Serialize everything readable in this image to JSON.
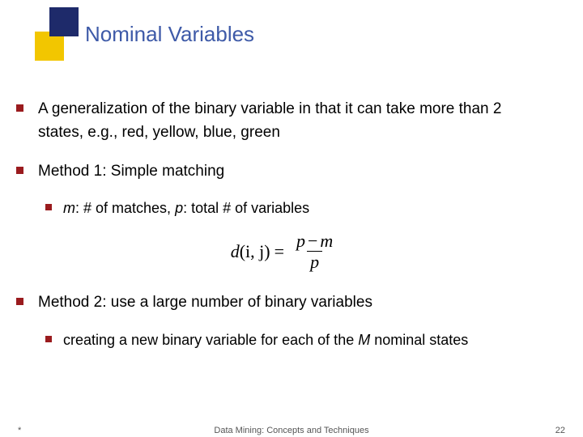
{
  "title": "Nominal Variables",
  "bullets": {
    "b1": "A generalization of the binary variable in that it can take more than 2 states, e.g., red, yellow, blue, green",
    "b2": "Method 1: Simple matching",
    "b2a_m": "m",
    "b2a_mid": ": # of matches, ",
    "b2a_p": "p",
    "b2a_end": ": total # of variables",
    "b3": "Method 2: use a large number of binary variables",
    "b3a_pre": "creating a new binary variable for each of the ",
    "b3a_M": "M",
    "b3a_post": " nominal states"
  },
  "formula": {
    "lhs_d": "d",
    "lhs_args": "(i, j)",
    "eq": "=",
    "num_p": "p",
    "num_minus": "−",
    "num_m": "m",
    "den": "p"
  },
  "footer": {
    "left": "*",
    "center": "Data Mining: Concepts and Techniques",
    "right": "22"
  }
}
